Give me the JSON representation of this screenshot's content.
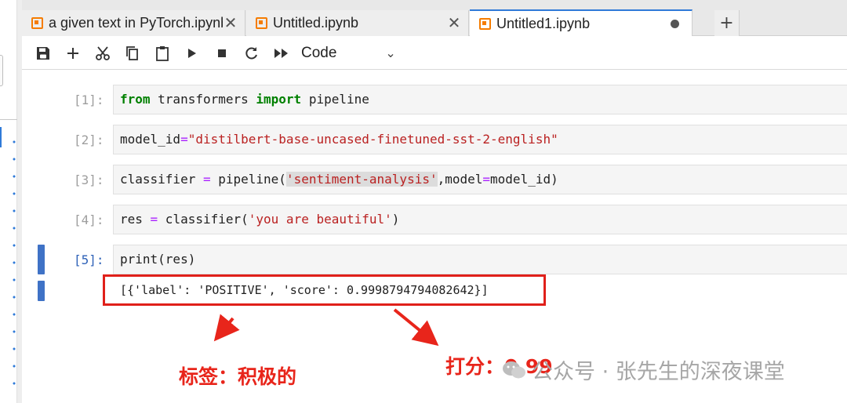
{
  "tabs": [
    {
      "label": "a given text in PyTorch.ipynb",
      "state": "close"
    },
    {
      "label": "Untitled.ipynb",
      "state": "close"
    },
    {
      "label": "Untitled1.ipynb",
      "state": "unsaved",
      "active": true
    }
  ],
  "add_tab_label": "+",
  "toolbar": {
    "buttons": [
      "save",
      "insert-cell",
      "cut",
      "copy",
      "paste",
      "run",
      "interrupt",
      "restart",
      "run-all"
    ],
    "cell_type": "Code"
  },
  "cells": [
    {
      "prompt": "[1]:",
      "code": "from transformers import pipeline"
    },
    {
      "prompt": "[2]:",
      "code": "model_id=\"distilbert-base-uncased-finetuned-sst-2-english\""
    },
    {
      "prompt": "[3]:",
      "code": "classifier = pipeline('sentiment-analysis',model=model_id)"
    },
    {
      "prompt": "[4]:",
      "code": "res = classifier('you are beautiful')"
    },
    {
      "prompt": "[5]:",
      "code": "print(res)",
      "output": "[{'label': 'POSITIVE', 'score': 0.9998794794082642}]"
    }
  ],
  "annotations": {
    "label_note": "标签：积极的",
    "score_note": "打分：0.99"
  },
  "watermark": "公众号 · 张先生的深夜课堂",
  "colors": {
    "accent": "#2f7ad8",
    "annotation_red": "#e8251b",
    "notebook_icon": "#f57c00"
  }
}
